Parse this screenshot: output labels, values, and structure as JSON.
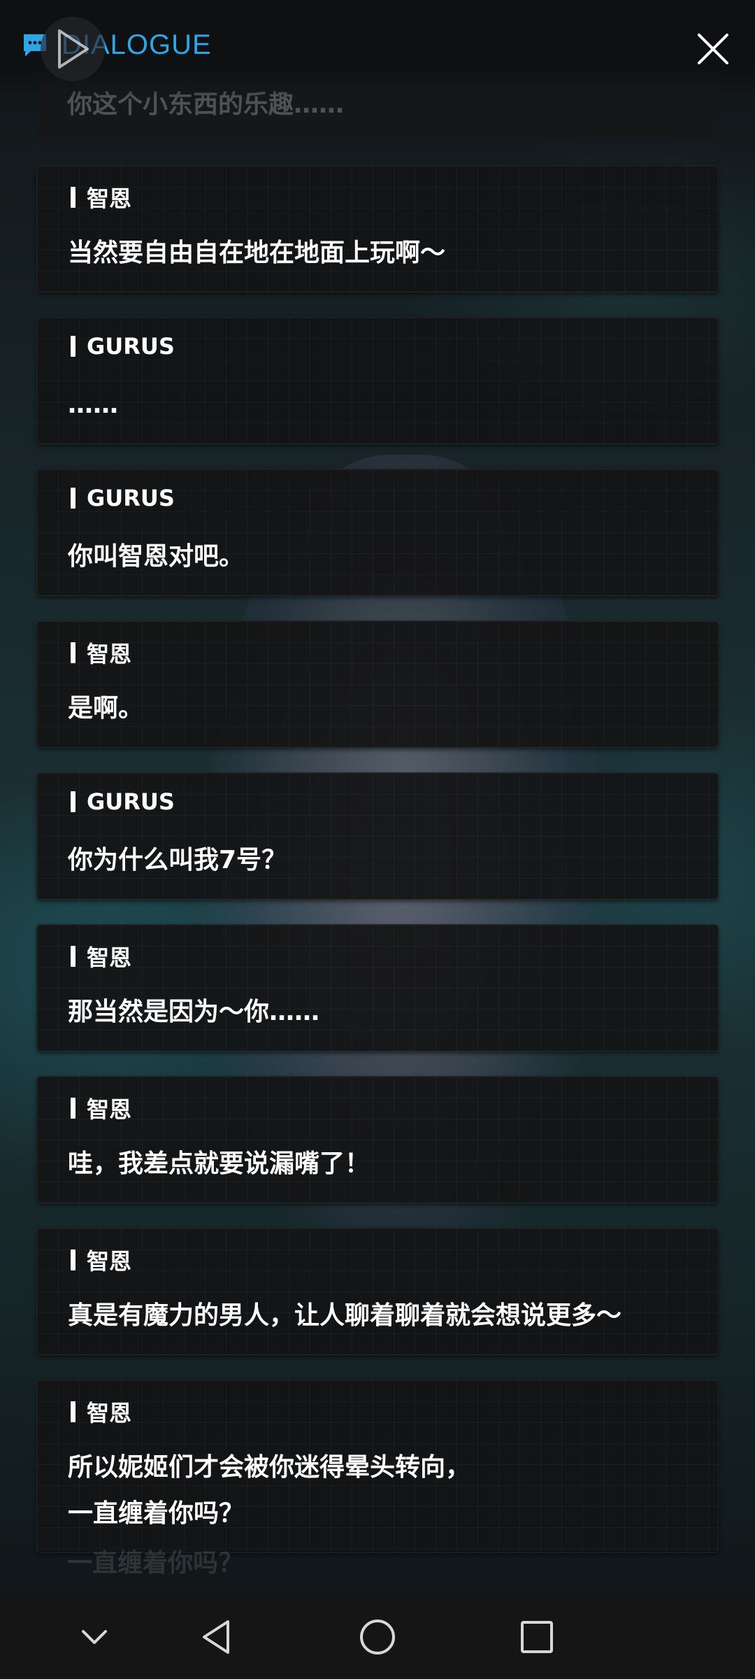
{
  "header": {
    "title": "DIALOGUE",
    "accent_color": "#2ea6e6",
    "chat_icon": "chat-bubble-icon",
    "close_icon": "close-icon",
    "play_icon": "play-icon"
  },
  "partial_top_text": "你这个小东西的乐趣……",
  "partial_bottom_text": "一直缠着你吗？",
  "dialogues": [
    {
      "speaker": "智恩",
      "text": "当然要自由自在地在地面上玩啊～"
    },
    {
      "speaker": "GURUS",
      "text": "……"
    },
    {
      "speaker": "GURUS",
      "text": "你叫智恩对吧。"
    },
    {
      "speaker": "智恩",
      "text": "是啊。"
    },
    {
      "speaker": "GURUS",
      "text": "你为什么叫我7号？"
    },
    {
      "speaker": "智恩",
      "text": "那当然是因为～你……"
    },
    {
      "speaker": "智恩",
      "text": "哇，我差点就要说漏嘴了！"
    },
    {
      "speaker": "智恩",
      "text": "真是有魔力的男人，让人聊着聊着就会想说更多～"
    },
    {
      "speaker": "智恩",
      "text": "所以妮姬们才会被你迷得晕头转向，\n一直缠着你吗？"
    }
  ],
  "navbar": {
    "buttons": [
      "chevron-down-icon",
      "back-triangle-icon",
      "home-circle-icon",
      "recents-square-icon"
    ]
  }
}
